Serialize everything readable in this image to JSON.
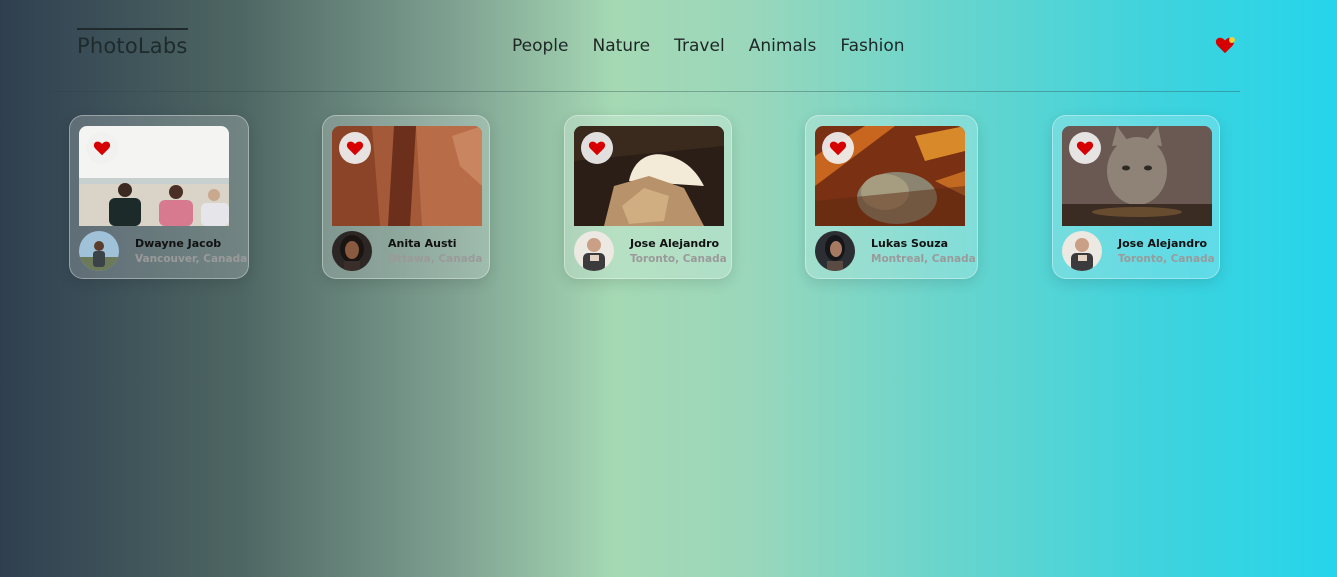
{
  "app": {
    "logo": "PhotoLabs"
  },
  "nav": {
    "topics": [
      "People",
      "Nature",
      "Travel",
      "Animals",
      "Fashion"
    ],
    "favorites_icon": "heart-icon",
    "favorites_badge": "notification-dot"
  },
  "colors": {
    "heart": "#d70000",
    "badge": "#e7d33a"
  },
  "photos": [
    {
      "user": "Dwayne Jacob",
      "location": "Vancouver, Canada",
      "image": "people-on-beach",
      "favorite_icon": "heart-icon"
    },
    {
      "user": "Anita Austi",
      "location": "Ottawa, Canada",
      "image": "canyon-rocks",
      "favorite_icon": "heart-icon"
    },
    {
      "user": "Jose Alejandro",
      "location": "Toronto, Canada",
      "image": "cave-arch",
      "favorite_icon": "heart-icon"
    },
    {
      "user": "Lukas Souza",
      "location": "Montreal, Canada",
      "image": "sleeping-cat",
      "favorite_icon": "heart-icon"
    },
    {
      "user": "Jose Alejandro",
      "location": "Toronto, Canada",
      "image": "cat-drinking",
      "favorite_icon": "heart-icon"
    }
  ]
}
